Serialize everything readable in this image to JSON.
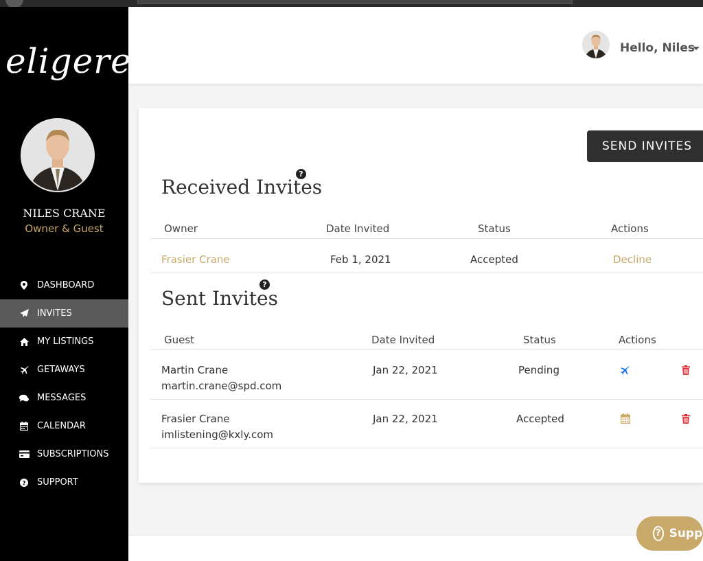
{
  "app": {
    "logo": "eligere"
  },
  "user": {
    "name": "NILES CRANE",
    "role": "Owner & Guest",
    "greeting": "Hello, Niles"
  },
  "nav": [
    {
      "label": "DASHBOARD",
      "icon": "map-marker-icon",
      "active": false
    },
    {
      "label": "INVITES",
      "icon": "paper-plane-icon",
      "active": true
    },
    {
      "label": "MY LISTINGS",
      "icon": "home-icon",
      "active": false
    },
    {
      "label": "GETAWAYS",
      "icon": "plane-icon",
      "active": false
    },
    {
      "label": "MESSAGES",
      "icon": "chat-icon",
      "active": false
    },
    {
      "label": "CALENDAR",
      "icon": "calendar-icon",
      "active": false
    },
    {
      "label": "SUBSCRIPTIONS",
      "icon": "credit-card-icon",
      "active": false
    },
    {
      "label": "SUPPORT",
      "icon": "question-circle-icon",
      "active": false
    }
  ],
  "send_invites_label": "SEND INVITES",
  "received": {
    "title": "Received Invites",
    "headers": {
      "owner": "Owner",
      "date": "Date Invited",
      "status": "Status",
      "actions": "Actions"
    },
    "rows": [
      {
        "owner": "Frasier Crane",
        "date": "Feb 1, 2021",
        "status": "Accepted",
        "action": "Decline"
      }
    ]
  },
  "sent": {
    "title": "Sent Invites",
    "headers": {
      "guest": "Guest",
      "date": "Date Invited",
      "status": "Status",
      "actions": "Actions"
    },
    "rows": [
      {
        "name": "Martin Crane",
        "email": "martin.crane@spd.com",
        "date": "Jan 22, 2021",
        "status": "Pending",
        "action_icon": "plane-icon"
      },
      {
        "name": "Frasier Crane",
        "email": "imlistening@kxly.com",
        "date": "Jan 22, 2021",
        "status": "Accepted",
        "action_icon": "calendar-icon"
      }
    ]
  },
  "support_label": "Support",
  "colors": {
    "accent": "#c9a96a",
    "sidebar": "#000000",
    "active_nav": "#5a5a5a",
    "delete": "#e0313b",
    "plane": "#1a73e8"
  }
}
